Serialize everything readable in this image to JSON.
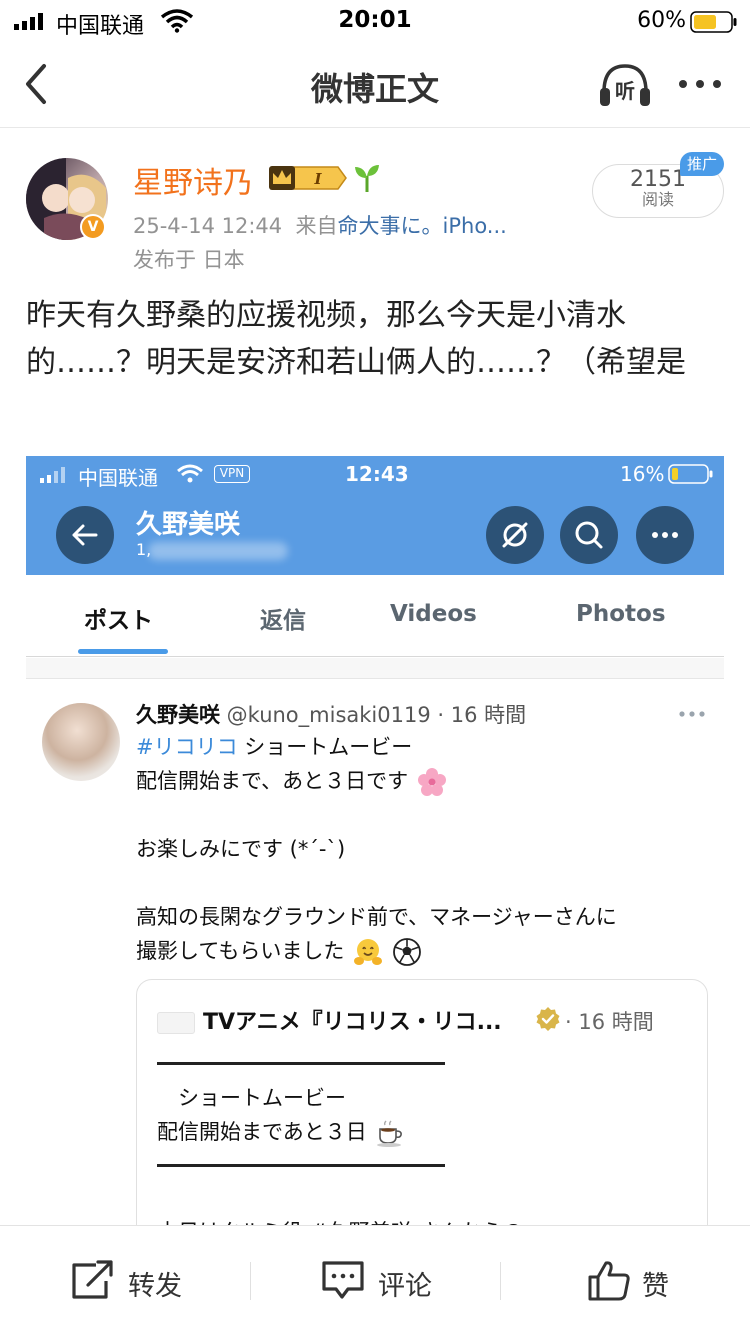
{
  "status_bar": {
    "carrier": "中国联通",
    "time": "20:01",
    "battery": "60%"
  },
  "nav": {
    "title": "微博正文",
    "listen_icon": "听"
  },
  "post": {
    "author": "星野诗乃",
    "badge_level": "I",
    "verified_mark": "V",
    "date": "25-4-14 12:44",
    "source_prefix": "来自",
    "source": "命大事に。iPho...",
    "location": "发布于 日本",
    "read_count": "2151",
    "read_label": "阅读",
    "promo_tag": "推广",
    "text": "昨天有久野桑的应援视频，那么今天是小清水的……？明天是安济和若山俩人的……？（希望是"
  },
  "embed": {
    "status_bar": {
      "carrier": "中国联通",
      "vpn": "VPN",
      "time": "12:43",
      "battery": "16%"
    },
    "profile_name": "久野美咲",
    "profile_sub": "1,",
    "tabs": [
      {
        "label": "ポスト"
      },
      {
        "label": "返信"
      },
      {
        "label": "Videos"
      },
      {
        "label": "Photos"
      }
    ],
    "tweet": {
      "display_name": "久野美咲",
      "handle_time": " @kuno_misaki0119 · 16 時間",
      "hashtag": "#リコリコ",
      "line1_rest": " ショートムービー",
      "line2": "配信開始まで、あと３日です",
      "line3": "お楽しみにです (*´-`)",
      "line4": "高知の長閑なグラウンド前で、マネージャーさんに",
      "line5": "撮影してもらいました"
    },
    "quote": {
      "title": "TVアニメ『リコリス・リコ...",
      "time": "· 16 時間",
      "line1": "　ショートムービー",
      "line2": "配信開始まであと３日",
      "cut_text": "本日はクルミ役 #久野美咲 さんからの"
    }
  },
  "toolbar": {
    "repost": "转发",
    "comment": "评论",
    "like": "赞"
  }
}
